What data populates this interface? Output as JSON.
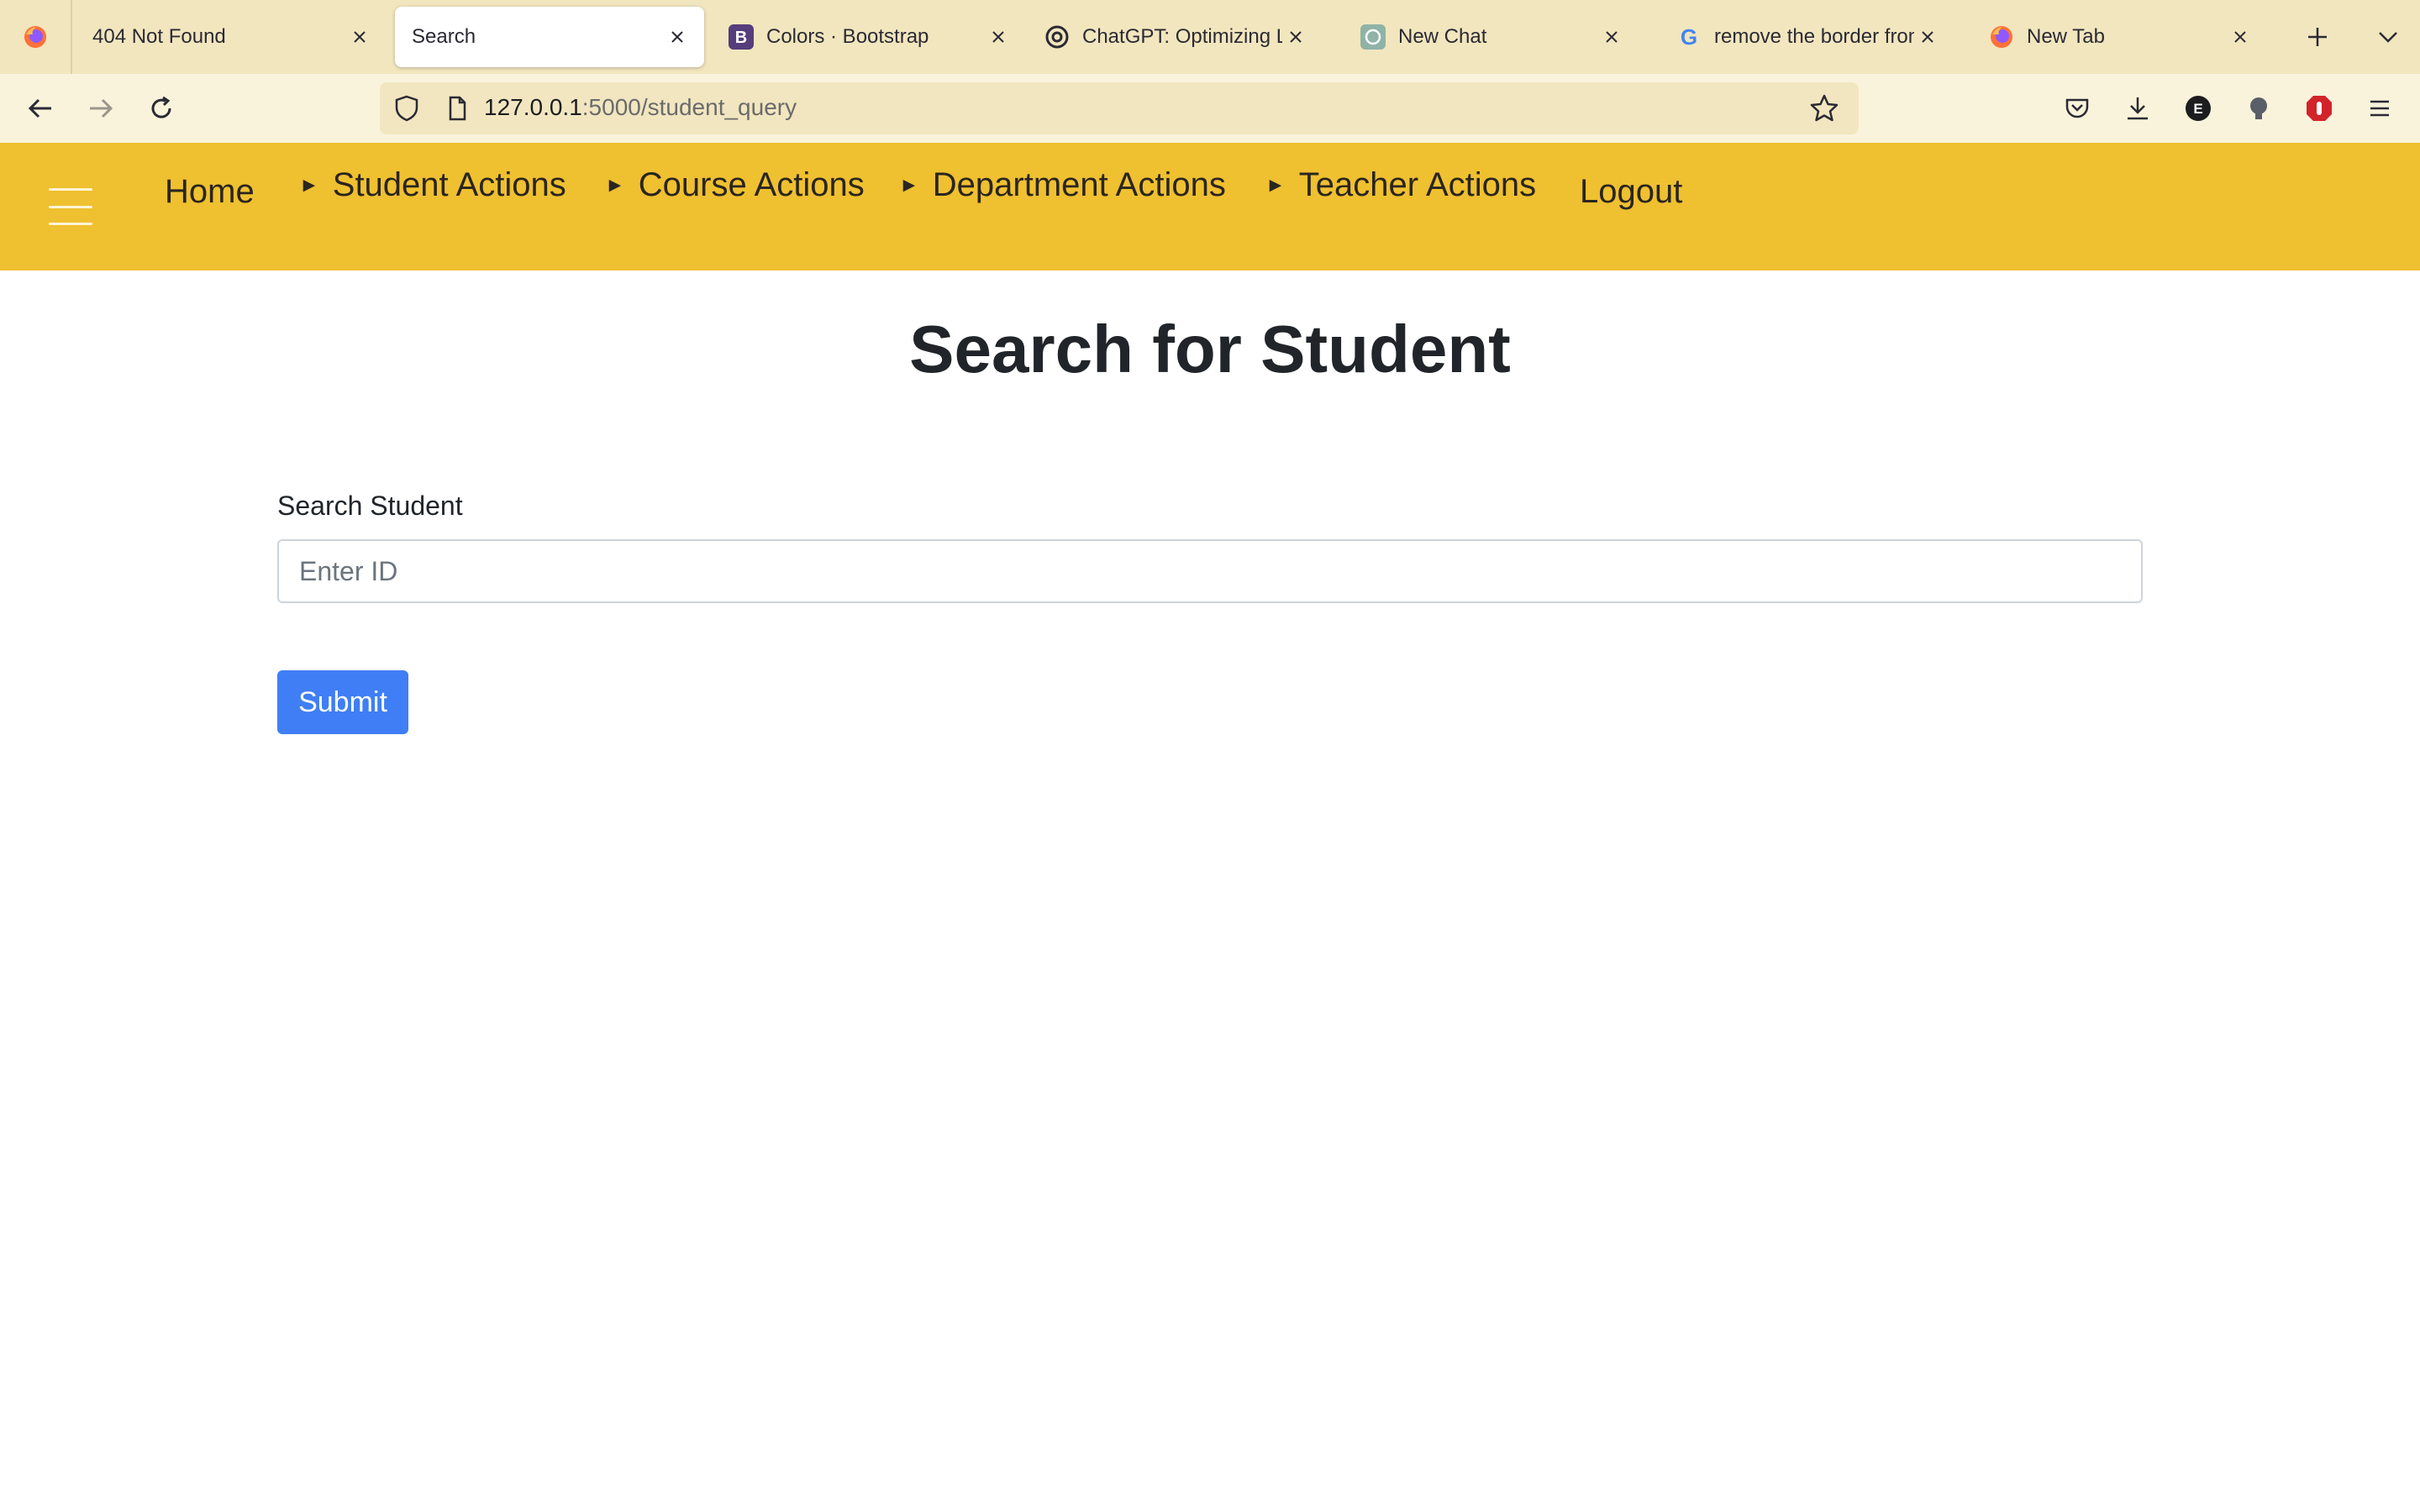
{
  "browser": {
    "tabs": [
      {
        "title": "404 Not Found",
        "icon": "firefox-icon"
      },
      {
        "title": "Search",
        "icon": "none",
        "active": true
      },
      {
        "title": "Colors · Bootstrap",
        "icon": "bootstrap-icon"
      },
      {
        "title": "ChatGPT: Optimizing Lan",
        "icon": "openai-icon"
      },
      {
        "title": "New Chat",
        "icon": "openai-icon"
      },
      {
        "title": "remove the border from s",
        "icon": "google-icon"
      },
      {
        "title": "New Tab",
        "icon": "firefox-icon"
      }
    ],
    "url": {
      "host": "127.0.0.1",
      "rest": ":5000/student_query"
    },
    "colors": {
      "tabbar": "#f2e6bf",
      "toolbar": "#faf3dc",
      "urlbar": "#f1e6c0"
    }
  },
  "nav": {
    "home": "Home",
    "student_actions": "Student Actions",
    "course_actions": "Course Actions",
    "department_actions": "Department Actions",
    "teacher_actions": "Teacher Actions",
    "logout": "Logout",
    "dropdown_marker": "►",
    "color": "#efc030"
  },
  "main": {
    "title": "Search for Student",
    "label": "Search Student",
    "input_placeholder": "Enter ID",
    "input_value": "",
    "submit_label": "Submit",
    "button_color": "#3f7ef5"
  }
}
